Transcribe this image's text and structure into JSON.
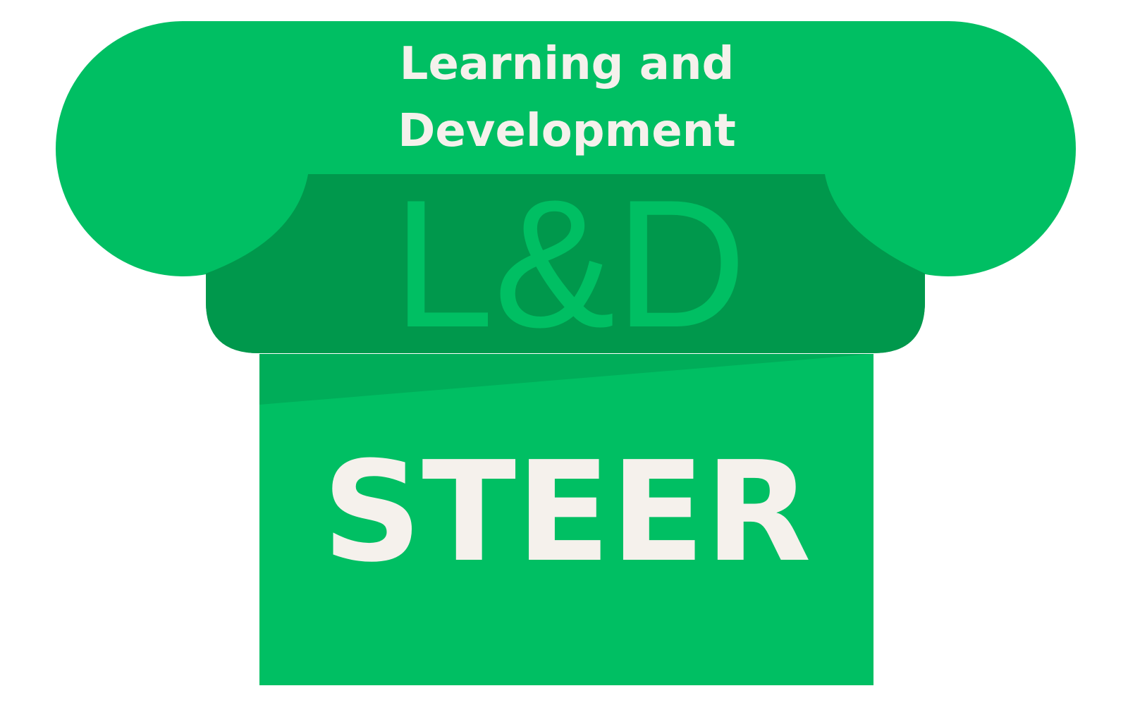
{
  "logo": {
    "line_1": "Learning and",
    "line_2": "Development",
    "monogram": "L&D",
    "wordmark": "STEER"
  },
  "colors": {
    "primary_green": "#00bf63",
    "dark_green": "#00984c",
    "stripe_green": "#00ad59",
    "text_light": "#f5f1ec",
    "background": "#ffffff"
  }
}
